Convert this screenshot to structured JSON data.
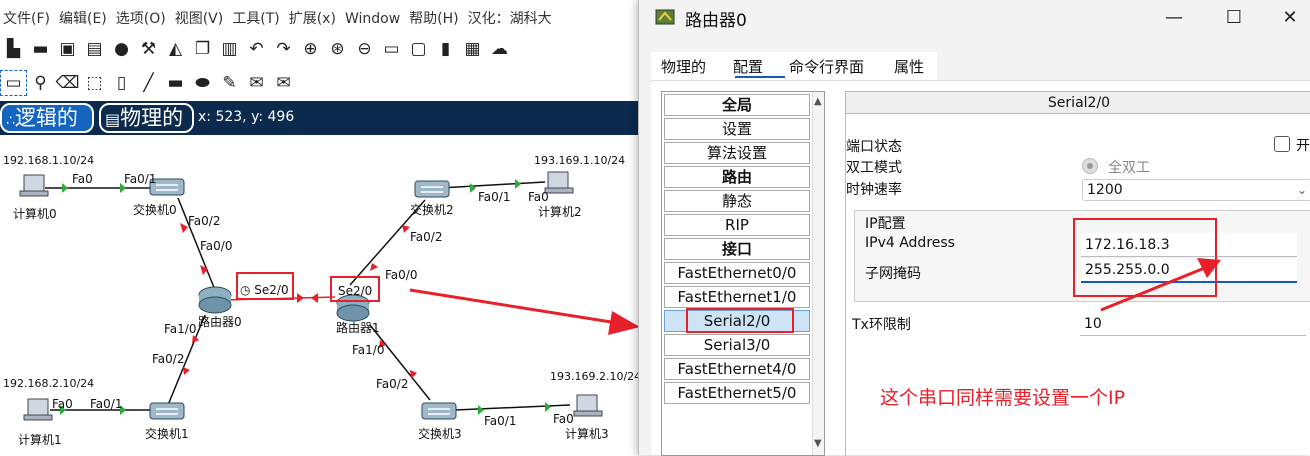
{
  "menu": [
    "文件(F)",
    "编辑(E)",
    "选项(O)",
    "视图(V)",
    "工具(T)",
    "扩展(x)",
    "Window",
    "帮助(H)",
    "汉化：湖科大"
  ],
  "toolbar1_icons": [
    "new-file-icon",
    "open-folder-icon",
    "save-icon",
    "print-icon",
    "info-icon",
    "wizard-icon",
    "activity-icon",
    "copy-icon",
    "paste-icon",
    "undo-icon",
    "redo-icon",
    "zoom-in-icon",
    "zoom-reset-icon",
    "zoom-out-icon",
    "window-icon",
    "window2-icon",
    "notes-icon",
    "switch-icon",
    "cloud-icon"
  ],
  "toolbar2_icons": [
    "select-icon",
    "search-icon",
    "delete-icon",
    "resize-icon",
    "note-icon",
    "line-icon",
    "rect-icon",
    "ellipse-icon",
    "freeform-icon",
    "envelope-icon",
    "open-envelope-icon"
  ],
  "modes": {
    "logical": "逻辑的",
    "physical": "物理的",
    "coords": "x: 523, y: 496"
  },
  "topology": {
    "ips": [
      "192.168.1.10/24",
      "193.169.1.10/24",
      "192.168.2.10/24",
      "193.169.2.10/24"
    ],
    "devices": [
      "计算机0",
      "交换机0",
      "计算机2",
      "交换机2",
      "路由器0",
      "路由器1",
      "计算机1",
      "交换机1",
      "交换机3",
      "计算机3"
    ],
    "ports": {
      "pc0_fa0": "Fa0",
      "sw0_fa01": "Fa0/1",
      "sw0_fa02": "Fa0/2",
      "r0_fa00": "Fa0/0",
      "r0_se20": "Se2/0",
      "r1_se20": "Se2/0",
      "r1_fa00": "Fa0/0",
      "sw2_fa02": "Fa0/2",
      "sw2_fa01": "Fa0/1",
      "pc2_fa0": "Fa0",
      "r0_fa10": "Fa1/0",
      "sw1_fa02": "Fa0/2",
      "pc1_fa0": "Fa0",
      "sw1_fa01": "Fa0/1",
      "r1_fa10": "Fa1/0",
      "sw3_fa02": "Fa0/2",
      "sw3_fa01": "Fa0/1",
      "pc3_fa0": "Fa0"
    }
  },
  "dialog": {
    "title": "路由器0",
    "tabs": [
      "物理的",
      "配置",
      "命令行界面",
      "属性"
    ],
    "nav": [
      {
        "label": "全局",
        "header": true
      },
      {
        "label": "设置"
      },
      {
        "label": "算法设置"
      },
      {
        "label": "路由",
        "header": true
      },
      {
        "label": "静态"
      },
      {
        "label": "RIP"
      },
      {
        "label": "接口",
        "header": true
      },
      {
        "label": "FastEthernet0/0"
      },
      {
        "label": "FastEthernet1/0"
      },
      {
        "label": "Serial2/0",
        "selected": true
      },
      {
        "label": "Serial3/0"
      },
      {
        "label": "FastEthernet4/0"
      },
      {
        "label": "FastEthernet5/0"
      }
    ],
    "panel": {
      "heading": "Serial2/0",
      "port_status_label": "端口状态",
      "port_on_label": "开",
      "duplex_label": "双工模式",
      "duplex_value": "全双工",
      "clock_label": "时钟速率",
      "clock_value": "1200",
      "ip_config_label": "IP配置",
      "ipv4_label": "IPv4 Address",
      "ipv4_value": "172.16.18.3",
      "mask_label": "子网掩码",
      "mask_value": "255.255.0.0",
      "tx_label": "Tx环限制",
      "tx_value": "10"
    }
  },
  "annotation": "这个串口同样需要设置一个IP",
  "colors": {
    "accent": "#1565c0",
    "annotation": "#e8202a",
    "modebar": "#0b2a4e",
    "link_ok": "#2eaa3a",
    "link_down": "#e8202a"
  }
}
